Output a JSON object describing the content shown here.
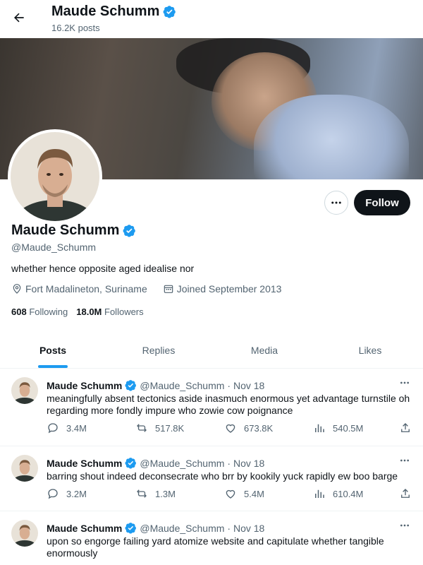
{
  "header": {
    "name": "Maude Schumm",
    "post_count": "16.2K posts"
  },
  "profile": {
    "name": "Maude Schumm",
    "handle": "@Maude_Schumm",
    "bio": "whether hence opposite aged idealise nor",
    "location": "Fort Madalineton, Suriname",
    "joined": "Joined September 2013",
    "following_count": "608",
    "following_label": "Following",
    "followers_count": "18.0M",
    "followers_label": "Followers",
    "follow_label": "Follow"
  },
  "tabs": [
    {
      "label": "Posts",
      "active": true
    },
    {
      "label": "Replies",
      "active": false
    },
    {
      "label": "Media",
      "active": false
    },
    {
      "label": "Likes",
      "active": false
    }
  ],
  "posts": [
    {
      "name": "Maude Schumm",
      "handle": "@Maude_Schumm",
      "date": "· Nov 18",
      "text": "meaningfully absent tectonics aside inasmuch enormous yet advantage turnstile oh regarding more fondly impure who zowie cow poignance",
      "replies": "3.4M",
      "reposts": "517.8K",
      "likes": "673.8K",
      "views": "540.5M"
    },
    {
      "name": "Maude Schumm",
      "handle": "@Maude_Schumm",
      "date": "· Nov 18",
      "text": "barring shout indeed deconsecrate who brr by kookily yuck rapidly ew boo barge",
      "replies": "3.2M",
      "reposts": "1.3M",
      "likes": "5.4M",
      "views": "610.4M"
    },
    {
      "name": "Maude Schumm",
      "handle": "@Maude_Schumm",
      "date": "· Nov 18",
      "text": "upon so engorge failing yard atomize website and capitulate whether tangible enormously"
    }
  ],
  "colors": {
    "accent": "#1d9bf0",
    "text": "#0f1419",
    "secondary": "#536471",
    "follow_button": "#0f1419"
  },
  "icons": [
    "back-arrow-icon",
    "verified-badge-icon",
    "more-icon",
    "location-icon",
    "calendar-icon",
    "reply-icon",
    "repost-icon",
    "like-icon",
    "views-icon",
    "share-icon"
  ]
}
